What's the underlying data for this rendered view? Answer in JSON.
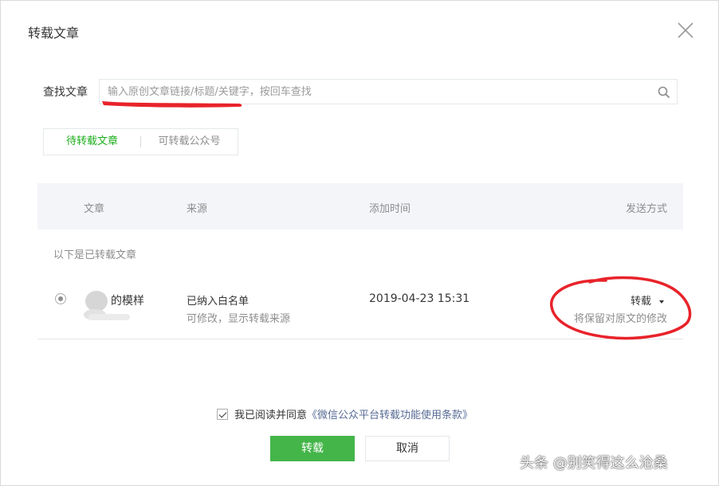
{
  "dialog": {
    "title": "转载文章"
  },
  "search": {
    "label": "查找文章",
    "placeholder": "输入原创文章链接/标题/关键字，按回车查找"
  },
  "tabs": [
    {
      "label": "待转载文章",
      "active": true
    },
    {
      "label": "可转载公众号",
      "active": false
    }
  ],
  "table": {
    "columns": [
      "文章",
      "来源",
      "添加时间",
      "发送方式"
    ],
    "section_note": "以下是已转载文章",
    "rows": [
      {
        "article": "的模样",
        "source_main": "已纳入白名单",
        "source_sub": "可修改，显示转载来源",
        "time": "2019-04-23 15:31",
        "mode": "转载",
        "mode_sub": "将保留对原文的修改"
      }
    ]
  },
  "agreement": {
    "text": "我已阅读并同意",
    "link": "《微信公众平台转载功能使用条款》",
    "checked": true
  },
  "buttons": {
    "confirm": "转载",
    "cancel": "取消"
  },
  "watermark": "头条 @别笑得这么沧桑",
  "colors": {
    "accent": "#44b549",
    "tab_active": "#1aad19",
    "link": "#576b95",
    "annotation": "#e8232a"
  }
}
